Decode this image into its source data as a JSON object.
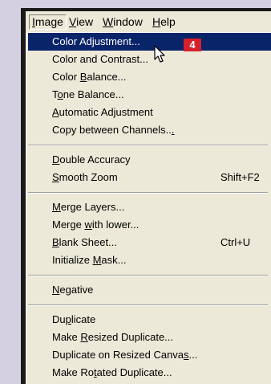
{
  "menubar": {
    "items": [
      {
        "label": "Image",
        "underline": 0
      },
      {
        "label": "View",
        "underline": 0
      },
      {
        "label": "Window",
        "underline": 0
      },
      {
        "label": "Help",
        "underline": 0
      }
    ]
  },
  "menu": {
    "groups": [
      [
        {
          "label": "Color Adjustment...",
          "underline": -1,
          "shortcut": "",
          "selected": true
        },
        {
          "label": "Color and Contrast...",
          "underline": -1,
          "shortcut": ""
        },
        {
          "label": "Color Balance...",
          "underline": 6,
          "shortcut": ""
        },
        {
          "label": "Tone Balance...",
          "underline": 1,
          "shortcut": ""
        },
        {
          "label": "Automatic Adjustment",
          "underline": 0,
          "shortcut": ""
        },
        {
          "label": "Copy between Channels...",
          "underline": 23,
          "shortcut": ""
        }
      ],
      [
        {
          "label": "Double Accuracy",
          "underline": 0,
          "shortcut": ""
        },
        {
          "label": "Smooth Zoom",
          "underline": 0,
          "shortcut": "Shift+F2"
        }
      ],
      [
        {
          "label": "Merge Layers...",
          "underline": 0,
          "shortcut": ""
        },
        {
          "label": "Merge with lower...",
          "underline": 6,
          "shortcut": ""
        },
        {
          "label": "Blank Sheet...",
          "underline": 0,
          "shortcut": "Ctrl+U"
        },
        {
          "label": "Initialize Mask...",
          "underline": 11,
          "shortcut": ""
        }
      ],
      [
        {
          "label": "Negative",
          "underline": 0,
          "shortcut": ""
        }
      ],
      [
        {
          "label": "Duplicate",
          "underline": 2,
          "shortcut": ""
        },
        {
          "label": "Make Resized Duplicate...",
          "underline": 5,
          "shortcut": ""
        },
        {
          "label": "Duplicate on Resized Canvas...",
          "underline": 26,
          "shortcut": ""
        },
        {
          "label": "Make Rotated Duplicate...",
          "underline": 7,
          "shortcut": ""
        }
      ]
    ]
  },
  "badge": "4",
  "colors": {
    "selection": "#0a246a",
    "badge": "#d6202c",
    "menu_bg": "#ece9d8"
  }
}
